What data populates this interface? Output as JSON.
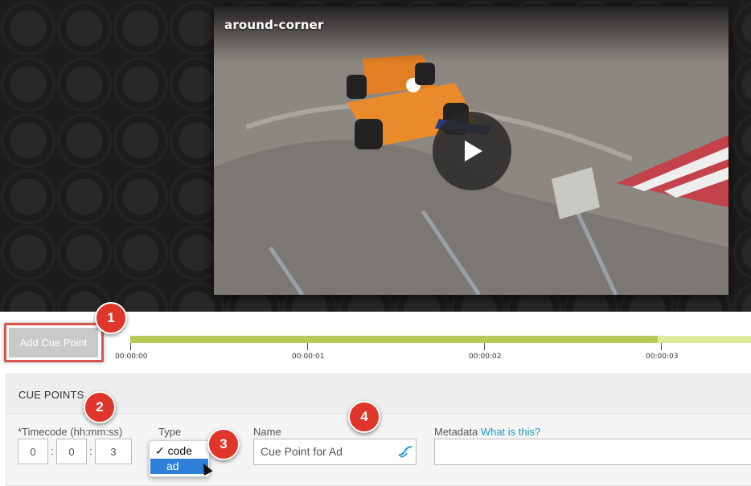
{
  "player": {
    "video_title": "around-corner"
  },
  "toolbar": {
    "add_cue_point_label": "Add Cue Point"
  },
  "timeline": {
    "ticks": [
      "00:00:00",
      "00:00:01",
      "00:00:02",
      "00:00:03"
    ],
    "played_fraction": 0.85,
    "colors": {
      "played": "#b5cc5a",
      "remaining": "#dcec9b"
    }
  },
  "cue_points": {
    "header": "CUE POINTS",
    "timecode_label": "*Timecode (hh:mm:ss)",
    "timecode": {
      "hh": "0",
      "mm": "0",
      "ss": "3"
    },
    "separator": ":",
    "type_label": "Type",
    "type_options": [
      {
        "label": "code",
        "checked": true
      },
      {
        "label": "ad",
        "checked": false,
        "highlighted": true
      }
    ],
    "check_mark": "✓",
    "name_label": "Name",
    "name_value": "Cue Point for Ad",
    "metadata_label": "Metadata",
    "metadata_link": "What is this?",
    "metadata_value": ""
  },
  "callouts": [
    "1",
    "2",
    "3",
    "4"
  ],
  "colors": {
    "callout": "#e0352b",
    "highlight": "#2f7ed8",
    "link": "#1a9ac9"
  }
}
